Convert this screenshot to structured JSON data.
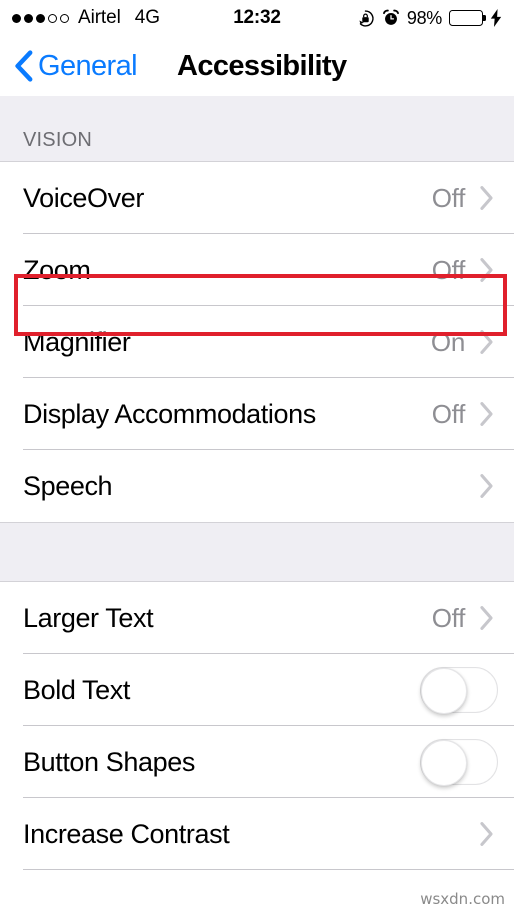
{
  "status_bar": {
    "signal_dots_filled": 3,
    "signal_dots_total": 5,
    "carrier": "Airtel",
    "network": "4G",
    "time": "12:32",
    "battery_percent": "98%",
    "battery_level": 98,
    "battery_color": "#4CD964",
    "icons": [
      "rotation-lock-icon",
      "alarm-clock-icon",
      "battery-icon",
      "charging-bolt-icon"
    ]
  },
  "nav_bar": {
    "back_label": "General",
    "title": "Accessibility",
    "accent_color": "#0a7bff"
  },
  "sections": [
    {
      "header": "VISION",
      "rows": [
        {
          "label": "VoiceOver",
          "value": "Off",
          "accessory": "chevron"
        },
        {
          "label": "Zoom",
          "value": "Off",
          "accessory": "chevron",
          "highlighted": true
        },
        {
          "label": "Magnifier",
          "value": "On",
          "accessory": "chevron"
        },
        {
          "label": "Display Accommodations",
          "value": "Off",
          "accessory": "chevron"
        },
        {
          "label": "Speech",
          "value": "",
          "accessory": "chevron"
        }
      ]
    },
    {
      "header": "",
      "rows": [
        {
          "label": "Larger Text",
          "value": "Off",
          "accessory": "chevron"
        },
        {
          "label": "Bold Text",
          "value": "",
          "accessory": "toggle",
          "toggle_on": false
        },
        {
          "label": "Button Shapes",
          "value": "",
          "accessory": "toggle",
          "toggle_on": false
        },
        {
          "label": "Increase Contrast",
          "value": "",
          "accessory": "chevron"
        }
      ]
    }
  ],
  "highlight": {
    "color": "#e0202c",
    "target": "Zoom"
  },
  "watermark": "wsxdn.com"
}
